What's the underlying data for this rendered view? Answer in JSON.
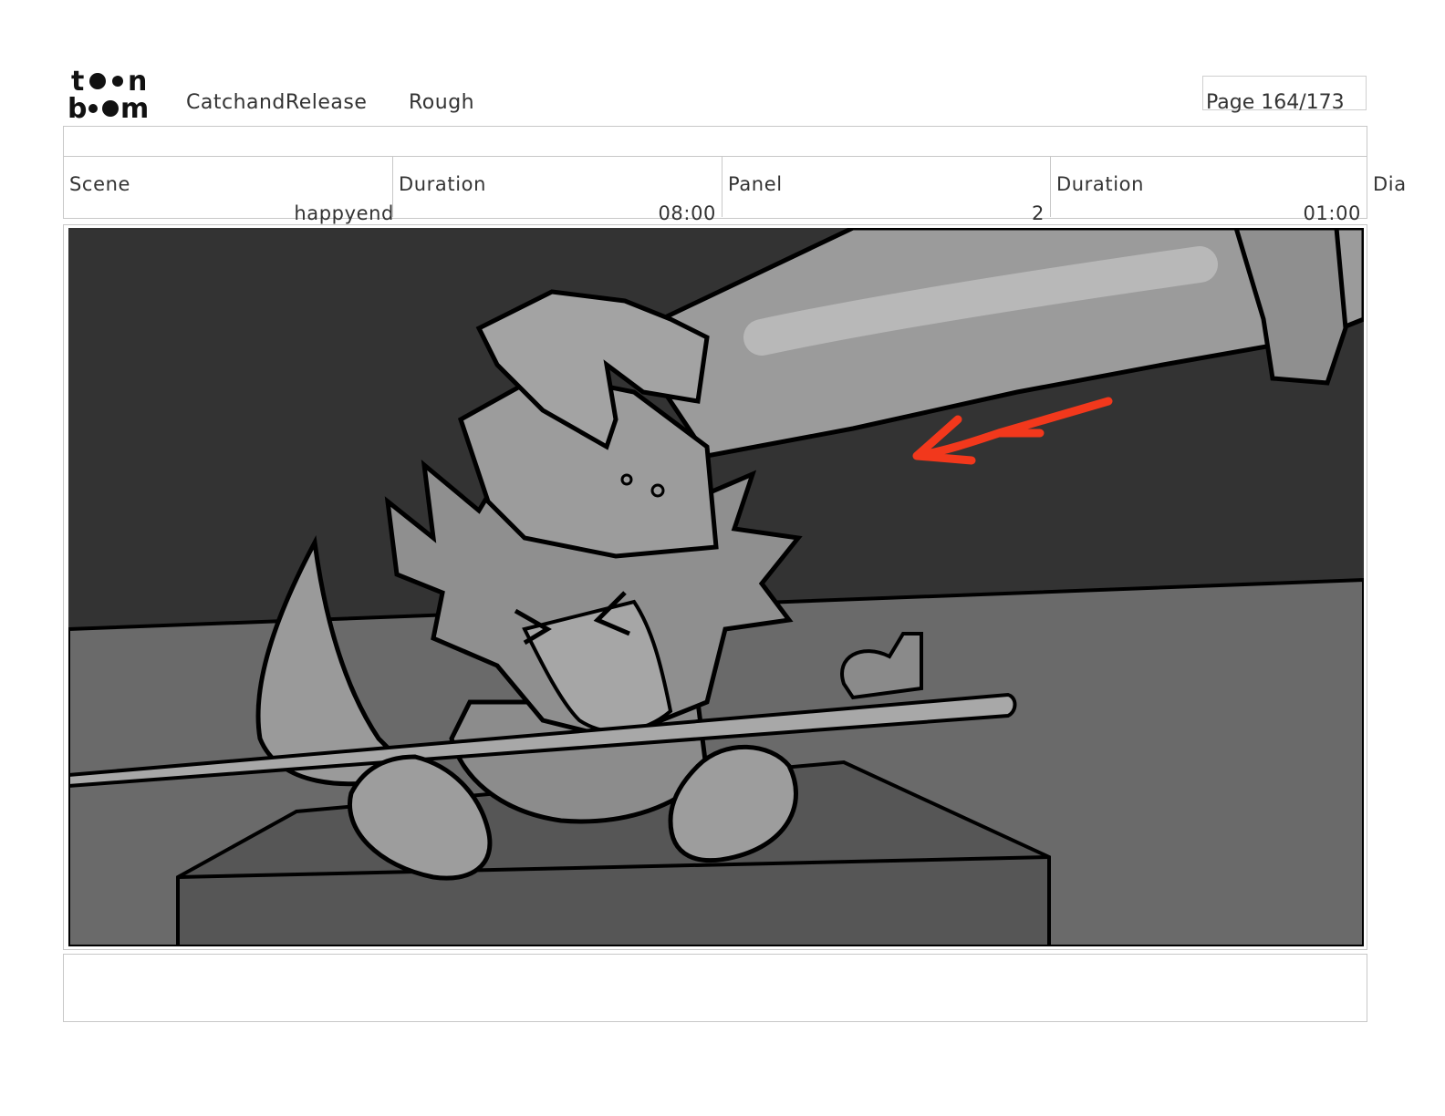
{
  "header": {
    "logo_text": "toonboom",
    "project": "CatchandRelease",
    "stage": "Rough",
    "page": "Page 164/173"
  },
  "info": {
    "scene_label": "Scene",
    "scene_value": "happyend",
    "scene_duration_label": "Duration",
    "scene_duration_value": "08:00",
    "panel_label": "Panel",
    "panel_value": "2",
    "panel_duration_label": "Duration",
    "panel_duration_value": "01:00",
    "dialogue_label": "Dia"
  },
  "colors": {
    "arrow": "#f2381c",
    "wall": "#333333",
    "floor": "#6a6a6a"
  }
}
